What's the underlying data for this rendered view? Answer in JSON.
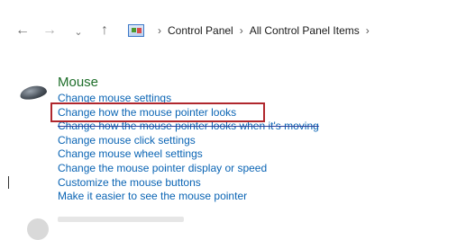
{
  "nav": {
    "back": "←",
    "forward": "→",
    "recent": "⌄",
    "up": "↑"
  },
  "address": {
    "icon": "control-panel-icon",
    "crumbs": [
      "Control Panel",
      "All Control Panel Items"
    ],
    "separator": "›"
  },
  "section": {
    "title": "Mouse",
    "icon": "mouse-icon",
    "links": [
      "Change mouse settings",
      "Change how the mouse pointer looks",
      "Change how the mouse pointer looks when it's moving",
      "Change mouse click settings",
      "Change mouse wheel settings",
      "Change the mouse pointer display or speed",
      "Customize the mouse buttons",
      "Make it easier to see the mouse pointer"
    ]
  },
  "colors": {
    "title_green": "#1e6e2a",
    "link_blue": "#0a64b4",
    "highlight_red": "#b0272d"
  }
}
